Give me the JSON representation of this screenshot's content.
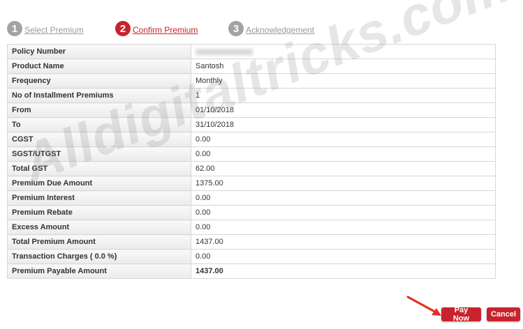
{
  "stepper": {
    "steps": [
      {
        "number": "1",
        "label": "Select Premium",
        "state": "inactive"
      },
      {
        "number": "2",
        "label": "Confirm Premium",
        "state": "active"
      },
      {
        "number": "3",
        "label": "Acknowledgement",
        "state": "inactive"
      }
    ]
  },
  "details": {
    "rows": [
      {
        "label": "Policy Number",
        "value": ""
      },
      {
        "label": "Product Name",
        "value": "Santosh"
      },
      {
        "label": "Frequency",
        "value": "Monthly"
      },
      {
        "label": "No of Installment Premiums",
        "value": "1"
      },
      {
        "label": "From",
        "value": "01/10/2018"
      },
      {
        "label": "To",
        "value": "31/10/2018"
      },
      {
        "label": "CGST",
        "value": "0.00"
      },
      {
        "label": "SGST/UTGST",
        "value": "0.00"
      },
      {
        "label": "Total GST",
        "value": "62.00"
      },
      {
        "label": "Premium Due Amount",
        "value": "1375.00"
      },
      {
        "label": "Premium Interest",
        "value": "0.00"
      },
      {
        "label": "Premium Rebate",
        "value": "0.00"
      },
      {
        "label": "Excess Amount",
        "value": "0.00"
      },
      {
        "label": "Total Premium Amount",
        "value": "1437.00"
      },
      {
        "label": "Transaction Charges ( 0.0 %)",
        "value": "0.00"
      },
      {
        "label": "Premium Payable Amount",
        "value": "1437.00"
      }
    ]
  },
  "watermark": "Alldigitaltricks.com",
  "buttons": {
    "pay_now": "Pay Now",
    "cancel": "Cancel"
  },
  "colors": {
    "accent": "#c8232c",
    "inactive_step": "#a3a3a3"
  }
}
